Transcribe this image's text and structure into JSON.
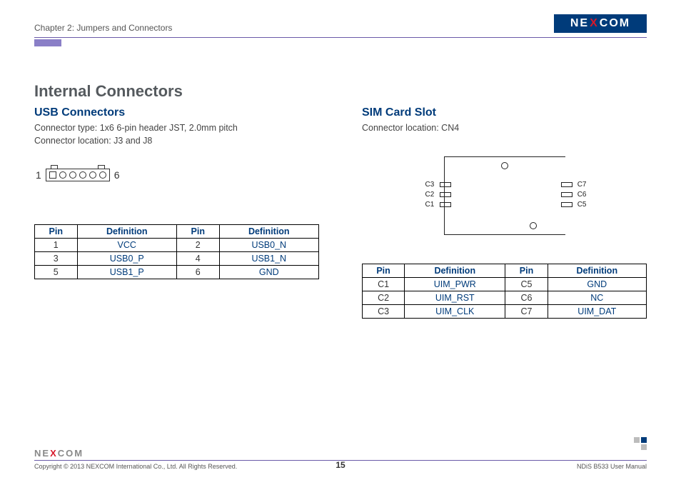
{
  "header": {
    "chapter": "Chapter 2: Jumpers and Connectors",
    "logo_text_pre": "NE",
    "logo_text_x": "X",
    "logo_text_post": "COM"
  },
  "section_title": "Internal Connectors",
  "usb": {
    "title": "USB Connectors",
    "desc_line1": "Connector type: 1x6 6-pin header JST, 2.0mm pitch",
    "desc_line2": "Connector location: J3 and J8",
    "pin_left": "1",
    "pin_right": "6",
    "table": {
      "headers": [
        "Pin",
        "Definition",
        "Pin",
        "Definition"
      ],
      "rows": [
        [
          "1",
          "VCC",
          "2",
          "USB0_N"
        ],
        [
          "3",
          "USB0_P",
          "4",
          "USB1_N"
        ],
        [
          "5",
          "USB1_P",
          "6",
          "GND"
        ]
      ]
    }
  },
  "sim": {
    "title": "SIM Card Slot",
    "desc_line1": "Connector location: CN4",
    "labels_left": [
      "C3",
      "C2",
      "C1"
    ],
    "labels_right": [
      "C7",
      "C6",
      "C5"
    ],
    "table": {
      "headers": [
        "Pin",
        "Definition",
        "Pin",
        "Definition"
      ],
      "rows": [
        [
          "C1",
          "UIM_PWR",
          "C5",
          "GND"
        ],
        [
          "C2",
          "UIM_RST",
          "C6",
          "NC"
        ],
        [
          "C3",
          "UIM_CLK",
          "C7",
          "UIM_DAT"
        ]
      ]
    }
  },
  "footer": {
    "copyright": "Copyright © 2013 NEXCOM International Co., Ltd. All Rights Reserved.",
    "page": "15",
    "manual": "NDiS B533 User Manual",
    "logo_pre": "NE",
    "logo_x": "X",
    "logo_post": "COM"
  }
}
